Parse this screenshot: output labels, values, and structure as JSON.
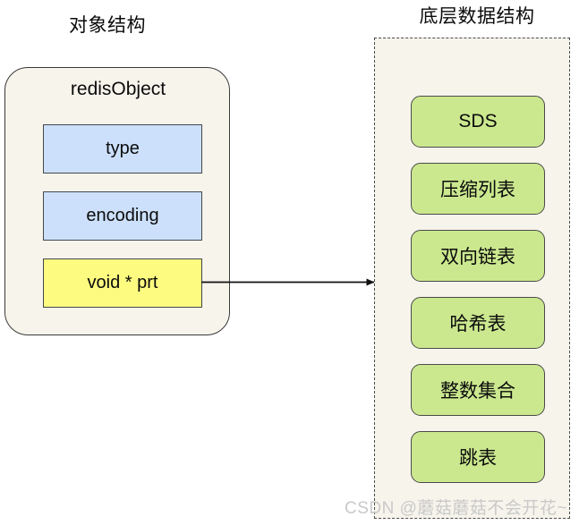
{
  "diagram": {
    "left_section": {
      "title": "对象结构",
      "panel_label": "redisObject",
      "fields": [
        {
          "label": "type",
          "color": "#cce0fb"
        },
        {
          "label": "encoding",
          "color": "#cce0fb"
        },
        {
          "label": "void * prt",
          "color": "#fdfb80"
        }
      ]
    },
    "right_section": {
      "title": "底层数据结构",
      "items": [
        {
          "label": "SDS"
        },
        {
          "label": "压缩列表"
        },
        {
          "label": "双向链表"
        },
        {
          "label": "哈希表"
        },
        {
          "label": "整数集合"
        },
        {
          "label": "跳表"
        }
      ]
    },
    "connector": {
      "name": "pointer-arrow",
      "from": "void * prt",
      "to": "底层数据结构",
      "color": "#111111"
    }
  },
  "watermark": {
    "text": "CSDN @蘑菇蘑菇不会开花~"
  },
  "palette": {
    "panel_fill": "#f7f4ec",
    "blue_fill": "#cce0fb",
    "yellow_fill": "#fdfb80",
    "green_fill": "#cbe88f",
    "stroke": "#4a4a4a",
    "background": "#ffffff"
  }
}
